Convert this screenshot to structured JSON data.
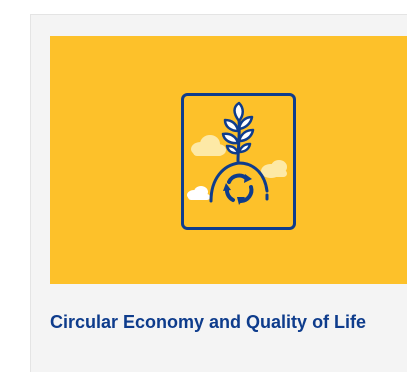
{
  "card": {
    "title": "Circular Economy and Quality of Life",
    "colors": {
      "banner": "#fdc12a",
      "title": "#0e3c8c",
      "icon_stroke": "#0e3c8c",
      "cloud": "#fde9a6",
      "card_background": "#f4f4f4"
    },
    "icon": "plant-with-recycling-arrows-icon"
  }
}
